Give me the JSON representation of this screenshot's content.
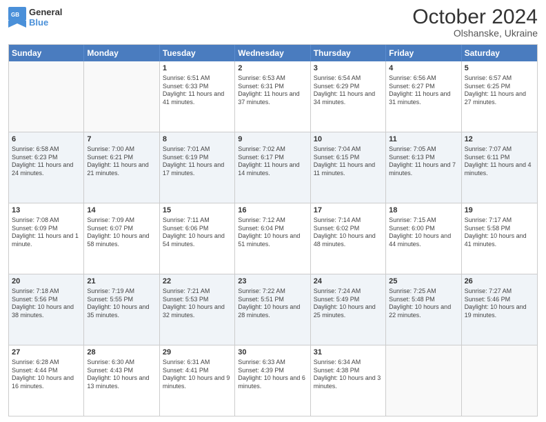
{
  "header": {
    "logo_line1": "General",
    "logo_line2": "Blue",
    "month": "October 2024",
    "location": "Olshanske, Ukraine"
  },
  "days_of_week": [
    "Sunday",
    "Monday",
    "Tuesday",
    "Wednesday",
    "Thursday",
    "Friday",
    "Saturday"
  ],
  "rows": [
    [
      {
        "day": "",
        "info": ""
      },
      {
        "day": "",
        "info": ""
      },
      {
        "day": "1",
        "info": "Sunrise: 6:51 AM\nSunset: 6:33 PM\nDaylight: 11 hours and 41 minutes."
      },
      {
        "day": "2",
        "info": "Sunrise: 6:53 AM\nSunset: 6:31 PM\nDaylight: 11 hours and 37 minutes."
      },
      {
        "day": "3",
        "info": "Sunrise: 6:54 AM\nSunset: 6:29 PM\nDaylight: 11 hours and 34 minutes."
      },
      {
        "day": "4",
        "info": "Sunrise: 6:56 AM\nSunset: 6:27 PM\nDaylight: 11 hours and 31 minutes."
      },
      {
        "day": "5",
        "info": "Sunrise: 6:57 AM\nSunset: 6:25 PM\nDaylight: 11 hours and 27 minutes."
      }
    ],
    [
      {
        "day": "6",
        "info": "Sunrise: 6:58 AM\nSunset: 6:23 PM\nDaylight: 11 hours and 24 minutes."
      },
      {
        "day": "7",
        "info": "Sunrise: 7:00 AM\nSunset: 6:21 PM\nDaylight: 11 hours and 21 minutes."
      },
      {
        "day": "8",
        "info": "Sunrise: 7:01 AM\nSunset: 6:19 PM\nDaylight: 11 hours and 17 minutes."
      },
      {
        "day": "9",
        "info": "Sunrise: 7:02 AM\nSunset: 6:17 PM\nDaylight: 11 hours and 14 minutes."
      },
      {
        "day": "10",
        "info": "Sunrise: 7:04 AM\nSunset: 6:15 PM\nDaylight: 11 hours and 11 minutes."
      },
      {
        "day": "11",
        "info": "Sunrise: 7:05 AM\nSunset: 6:13 PM\nDaylight: 11 hours and 7 minutes."
      },
      {
        "day": "12",
        "info": "Sunrise: 7:07 AM\nSunset: 6:11 PM\nDaylight: 11 hours and 4 minutes."
      }
    ],
    [
      {
        "day": "13",
        "info": "Sunrise: 7:08 AM\nSunset: 6:09 PM\nDaylight: 11 hours and 1 minute."
      },
      {
        "day": "14",
        "info": "Sunrise: 7:09 AM\nSunset: 6:07 PM\nDaylight: 10 hours and 58 minutes."
      },
      {
        "day": "15",
        "info": "Sunrise: 7:11 AM\nSunset: 6:06 PM\nDaylight: 10 hours and 54 minutes."
      },
      {
        "day": "16",
        "info": "Sunrise: 7:12 AM\nSunset: 6:04 PM\nDaylight: 10 hours and 51 minutes."
      },
      {
        "day": "17",
        "info": "Sunrise: 7:14 AM\nSunset: 6:02 PM\nDaylight: 10 hours and 48 minutes."
      },
      {
        "day": "18",
        "info": "Sunrise: 7:15 AM\nSunset: 6:00 PM\nDaylight: 10 hours and 44 minutes."
      },
      {
        "day": "19",
        "info": "Sunrise: 7:17 AM\nSunset: 5:58 PM\nDaylight: 10 hours and 41 minutes."
      }
    ],
    [
      {
        "day": "20",
        "info": "Sunrise: 7:18 AM\nSunset: 5:56 PM\nDaylight: 10 hours and 38 minutes."
      },
      {
        "day": "21",
        "info": "Sunrise: 7:19 AM\nSunset: 5:55 PM\nDaylight: 10 hours and 35 minutes."
      },
      {
        "day": "22",
        "info": "Sunrise: 7:21 AM\nSunset: 5:53 PM\nDaylight: 10 hours and 32 minutes."
      },
      {
        "day": "23",
        "info": "Sunrise: 7:22 AM\nSunset: 5:51 PM\nDaylight: 10 hours and 28 minutes."
      },
      {
        "day": "24",
        "info": "Sunrise: 7:24 AM\nSunset: 5:49 PM\nDaylight: 10 hours and 25 minutes."
      },
      {
        "day": "25",
        "info": "Sunrise: 7:25 AM\nSunset: 5:48 PM\nDaylight: 10 hours and 22 minutes."
      },
      {
        "day": "26",
        "info": "Sunrise: 7:27 AM\nSunset: 5:46 PM\nDaylight: 10 hours and 19 minutes."
      }
    ],
    [
      {
        "day": "27",
        "info": "Sunrise: 6:28 AM\nSunset: 4:44 PM\nDaylight: 10 hours and 16 minutes."
      },
      {
        "day": "28",
        "info": "Sunrise: 6:30 AM\nSunset: 4:43 PM\nDaylight: 10 hours and 13 minutes."
      },
      {
        "day": "29",
        "info": "Sunrise: 6:31 AM\nSunset: 4:41 PM\nDaylight: 10 hours and 9 minutes."
      },
      {
        "day": "30",
        "info": "Sunrise: 6:33 AM\nSunset: 4:39 PM\nDaylight: 10 hours and 6 minutes."
      },
      {
        "day": "31",
        "info": "Sunrise: 6:34 AM\nSunset: 4:38 PM\nDaylight: 10 hours and 3 minutes."
      },
      {
        "day": "",
        "info": ""
      },
      {
        "day": "",
        "info": ""
      }
    ]
  ],
  "alt_rows": [
    1,
    3
  ]
}
